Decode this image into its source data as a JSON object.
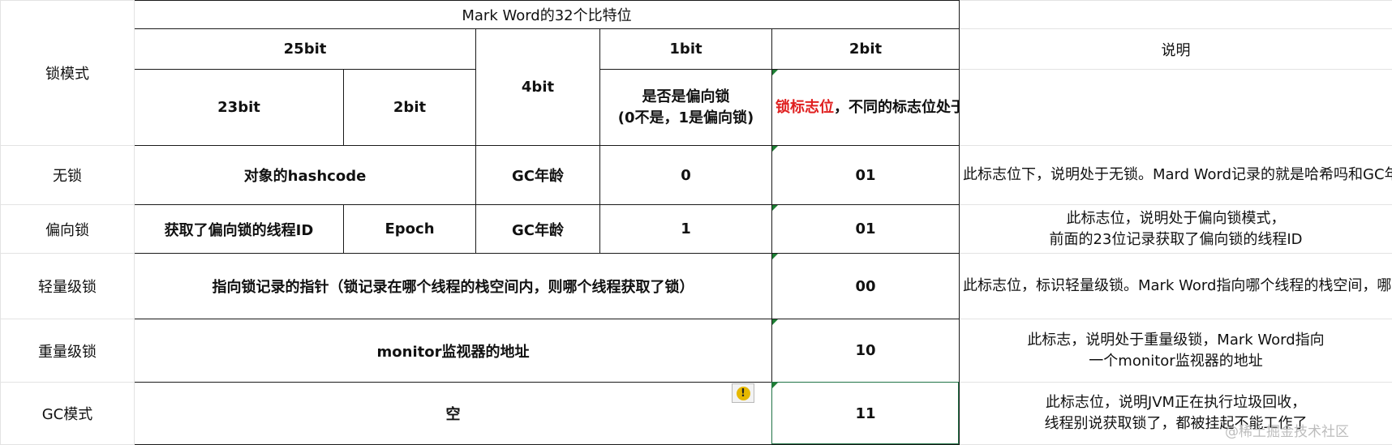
{
  "header": {
    "lock_mode": "锁模式",
    "title": "Mark Word的32个比特位",
    "bit25": "25bit",
    "bit23": "23bit",
    "bit2a": "2bit",
    "bit4": "4bit",
    "bit1": "1bit",
    "bit2": "2bit",
    "desc": "说明",
    "biased_desc": "是否是偏向锁\n(0不是，1是偏向锁)",
    "flag_red": "锁标志位",
    "flag_rest": "，不同的标志位处于不同的锁模式"
  },
  "rows": {
    "unlocked": {
      "mode": "无锁",
      "hash": "对象的hashcode",
      "age": "GC年龄",
      "biased": "0",
      "flag": "01",
      "desc": "此标志位下，说明处于无锁。Mard Word记录的就是哈希吗和GC年龄"
    },
    "biased": {
      "mode": "偏向锁",
      "thread": "获取了偏向锁的线程ID",
      "epoch": "Epoch",
      "age": "GC年龄",
      "biased": "1",
      "flag": "01",
      "desc": "此标志位，说明处于偏向锁模式，\n前面的23位记录获取了偏向锁的线程ID"
    },
    "lightweight": {
      "mode": "轻量级锁",
      "pointer": "指向锁记录的指针（锁记录在哪个线程的栈空间内，则哪个线程获取了锁）",
      "flag": "00",
      "desc": "此标志位，标识轻量级锁。Mark Word指向哪个线程的栈空间，哪个线程就获取了锁"
    },
    "heavyweight": {
      "mode": "重量级锁",
      "monitor": "monitor监视器的地址",
      "flag": "10",
      "desc": "此标志，说明处于重量级锁，Mark Word指向\n一个monitor监视器的地址"
    },
    "gc": {
      "mode": "GC模式",
      "empty": "空",
      "flag": "11",
      "desc": "此标志位，说明JVM正在执行垃圾回收，\n线程别说获取锁了，都被挂起不能工作了"
    }
  },
  "overlay": {
    "warning": "!",
    "watermark": "@稀土掘金技术社区"
  },
  "colors": {
    "red": "#e02020",
    "grid": "#1a1a1a",
    "selection": "#217346",
    "warning": "#e6b800"
  }
}
